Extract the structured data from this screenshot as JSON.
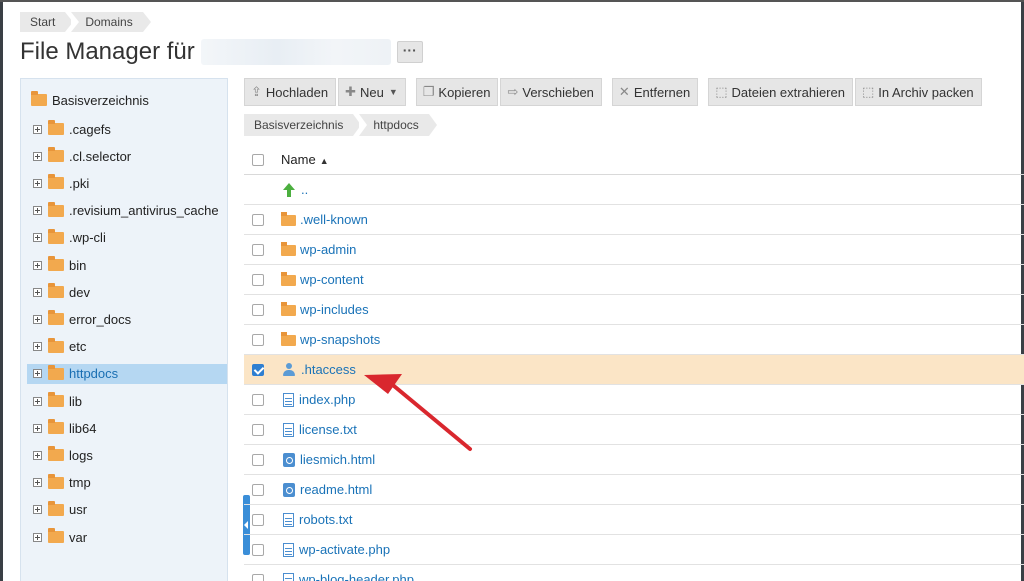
{
  "breadcrumbs": [
    "Start",
    "Domains"
  ],
  "title": "File Manager für",
  "more_label": "···",
  "sidebar": {
    "root": "Basisverzeichnis",
    "items": [
      ".cagefs",
      ".cl.selector",
      ".pki",
      ".revisium_antivirus_cache",
      ".wp-cli",
      "bin",
      "dev",
      "error_docs",
      "etc",
      "httpdocs",
      "lib",
      "lib64",
      "logs",
      "tmp",
      "usr",
      "var"
    ],
    "selected": "httpdocs"
  },
  "toolbar": {
    "upload": "Hochladen",
    "new": "Neu",
    "copy": "Kopieren",
    "move": "Verschieben",
    "remove": "Entfernen",
    "extract": "Dateien extrahieren",
    "archive": "In Archiv packen"
  },
  "path": [
    "Basisverzeichnis",
    "httpdocs"
  ],
  "table": {
    "header": "Name",
    "up_label": "..",
    "rows": [
      {
        "name": ".well-known",
        "type": "folder"
      },
      {
        "name": "wp-admin",
        "type": "folder"
      },
      {
        "name": "wp-content",
        "type": "folder"
      },
      {
        "name": "wp-includes",
        "type": "folder"
      },
      {
        "name": "wp-snapshots",
        "type": "folder"
      },
      {
        "name": ".htaccess",
        "type": "htaccess",
        "checked": true
      },
      {
        "name": "index.php",
        "type": "file"
      },
      {
        "name": "license.txt",
        "type": "file"
      },
      {
        "name": "liesmich.html",
        "type": "html"
      },
      {
        "name": "readme.html",
        "type": "html"
      },
      {
        "name": "robots.txt",
        "type": "file"
      },
      {
        "name": "wp-activate.php",
        "type": "file"
      },
      {
        "name": "wp-blog-header.php",
        "type": "file"
      }
    ]
  },
  "colors": {
    "selected_row": "#fbe5c6",
    "link": "#1a73b8",
    "sidebar_bg": "#edf3f9",
    "annotation_arrow": "#d9272e"
  }
}
